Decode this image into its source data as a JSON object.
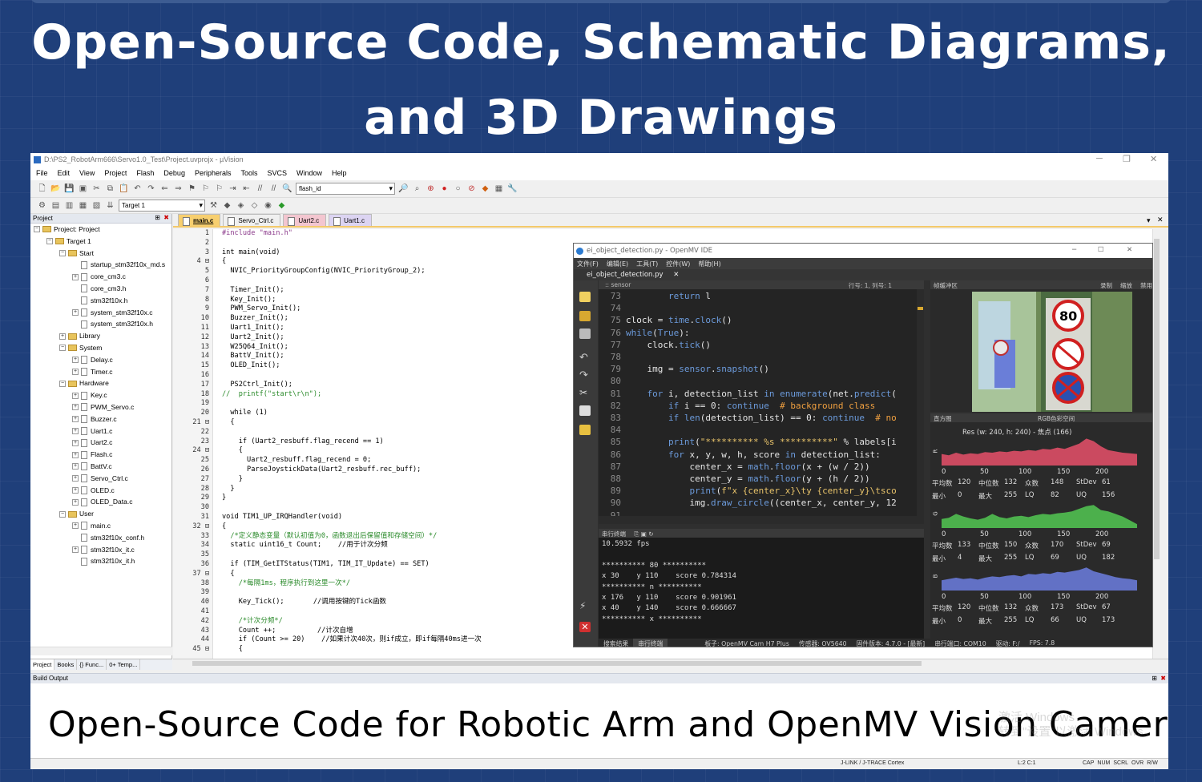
{
  "banner": {
    "line1": "Open-Source Code, Schematic Diagrams,",
    "line2": "and 3D Drawings"
  },
  "caption": "Open-Source Code for Robotic Arm and OpenMV Vision Camera",
  "watermark": {
    "line1": "激活 Windows",
    "line2": "转到\"设置\"以激活 Windows。"
  },
  "keil": {
    "title": "D:\\PS2_RobotArm666\\Servo1.0_Test\\Project.uvprojx - µVision",
    "menu": [
      "File",
      "Edit",
      "View",
      "Project",
      "Flash",
      "Debug",
      "Peripherals",
      "Tools",
      "SVCS",
      "Window",
      "Help"
    ],
    "find_combo": "flash_id",
    "target_combo": "Target 1",
    "project_header": "Project",
    "tree": [
      {
        "d": 0,
        "exp": "−",
        "icon": "proj",
        "label": "Project: Project"
      },
      {
        "d": 1,
        "exp": "−",
        "icon": "target",
        "label": "Target 1"
      },
      {
        "d": 2,
        "exp": "−",
        "icon": "folder",
        "label": "Start"
      },
      {
        "d": 3,
        "exp": "",
        "icon": "file",
        "label": "startup_stm32f10x_md.s"
      },
      {
        "d": 3,
        "exp": "+",
        "icon": "file",
        "label": "core_cm3.c"
      },
      {
        "d": 3,
        "exp": "",
        "icon": "file",
        "label": "core_cm3.h"
      },
      {
        "d": 3,
        "exp": "",
        "icon": "file",
        "label": "stm32f10x.h"
      },
      {
        "d": 3,
        "exp": "+",
        "icon": "file",
        "label": "system_stm32f10x.c"
      },
      {
        "d": 3,
        "exp": "",
        "icon": "file",
        "label": "system_stm32f10x.h"
      },
      {
        "d": 2,
        "exp": "+",
        "icon": "folder",
        "label": "Library"
      },
      {
        "d": 2,
        "exp": "−",
        "icon": "folder",
        "label": "System"
      },
      {
        "d": 3,
        "exp": "+",
        "icon": "file",
        "label": "Delay.c"
      },
      {
        "d": 3,
        "exp": "+",
        "icon": "file",
        "label": "Timer.c"
      },
      {
        "d": 2,
        "exp": "−",
        "icon": "folder",
        "label": "Hardware"
      },
      {
        "d": 3,
        "exp": "+",
        "icon": "file",
        "label": "Key.c"
      },
      {
        "d": 3,
        "exp": "+",
        "icon": "file",
        "label": "PWM_Servo.c"
      },
      {
        "d": 3,
        "exp": "+",
        "icon": "file",
        "label": "Buzzer.c"
      },
      {
        "d": 3,
        "exp": "+",
        "icon": "file",
        "label": "Uart1.c"
      },
      {
        "d": 3,
        "exp": "+",
        "icon": "file",
        "label": "Uart2.c"
      },
      {
        "d": 3,
        "exp": "+",
        "icon": "file",
        "label": "Flash.c"
      },
      {
        "d": 3,
        "exp": "+",
        "icon": "file",
        "label": "BattV.c"
      },
      {
        "d": 3,
        "exp": "+",
        "icon": "file",
        "label": "Servo_Ctrl.c"
      },
      {
        "d": 3,
        "exp": "+",
        "icon": "file",
        "label": "OLED.c"
      },
      {
        "d": 3,
        "exp": "+",
        "icon": "file",
        "label": "OLED_Data.c"
      },
      {
        "d": 2,
        "exp": "−",
        "icon": "folder",
        "label": "User"
      },
      {
        "d": 3,
        "exp": "+",
        "icon": "file",
        "label": "main.c"
      },
      {
        "d": 3,
        "exp": "",
        "icon": "file",
        "label": "stm32f10x_conf.h"
      },
      {
        "d": 3,
        "exp": "+",
        "icon": "file",
        "label": "stm32f10x_it.c"
      },
      {
        "d": 3,
        "exp": "",
        "icon": "file",
        "label": "stm32f10x_it.h"
      }
    ],
    "pane_tabs": [
      "Project",
      "Books",
      "{} Func...",
      "0+ Temp..."
    ],
    "editor_tabs": [
      "main.c",
      "Servo_Ctrl.c",
      "Uart2.c",
      "Uart1.c"
    ],
    "code": [
      {
        "t": "#include \"main.h\"",
        "k": "pp"
      },
      {
        "t": "",
        "k": ""
      },
      {
        "t": "int main(void)",
        "k": ""
      },
      {
        "t": "{",
        "k": ""
      },
      {
        "t": "  NVIC_PriorityGroupConfig(NVIC_PriorityGroup_2);",
        "k": ""
      },
      {
        "t": "",
        "k": ""
      },
      {
        "t": "  Timer_Init();",
        "k": ""
      },
      {
        "t": "  Key_Init();",
        "k": ""
      },
      {
        "t": "  PWM_Servo_Init();",
        "k": ""
      },
      {
        "t": "  Buzzer_Init();",
        "k": ""
      },
      {
        "t": "  Uart1_Init();",
        "k": ""
      },
      {
        "t": "  Uart2_Init();",
        "k": ""
      },
      {
        "t": "  W25Q64_Init();",
        "k": ""
      },
      {
        "t": "  BattV_Init();",
        "k": ""
      },
      {
        "t": "  OLED_Init();",
        "k": ""
      },
      {
        "t": "",
        "k": ""
      },
      {
        "t": "  PS2Ctrl_Init();",
        "k": ""
      },
      {
        "t": "//  printf(\"start\\r\\n\");",
        "k": "cm"
      },
      {
        "t": "",
        "k": ""
      },
      {
        "t": "  while (1)",
        "k": ""
      },
      {
        "t": "  {",
        "k": ""
      },
      {
        "t": "",
        "k": ""
      },
      {
        "t": "    if (Uart2_resbuff.flag_recend == 1)",
        "k": ""
      },
      {
        "t": "    {",
        "k": ""
      },
      {
        "t": "      Uart2_resbuff.flag_recend = 0;",
        "k": ""
      },
      {
        "t": "      ParseJoystickData(Uart2_resbuff.rec_buff);",
        "k": ""
      },
      {
        "t": "    }",
        "k": ""
      },
      {
        "t": "  }",
        "k": ""
      },
      {
        "t": "}",
        "k": ""
      },
      {
        "t": "",
        "k": ""
      },
      {
        "t": "void TIM1_UP_IRQHandler(void)",
        "k": ""
      },
      {
        "t": "{",
        "k": ""
      },
      {
        "t": "  /*定义静态变量（默认初值为0，函数退出后保留值和存储空间）*/",
        "k": "cm"
      },
      {
        "t": "  static uint16_t Count;    //用于计次分频",
        "k": ""
      },
      {
        "t": "",
        "k": ""
      },
      {
        "t": "  if (TIM_GetITStatus(TIM1, TIM_IT_Update) == SET)",
        "k": ""
      },
      {
        "t": "  {",
        "k": ""
      },
      {
        "t": "    /*每隔1ms，程序执行到这里一次*/",
        "k": "cm"
      },
      {
        "t": "",
        "k": ""
      },
      {
        "t": "    Key_Tick();       //调用按键的Tick函数",
        "k": ""
      },
      {
        "t": "",
        "k": ""
      },
      {
        "t": "    /*计次分频*/",
        "k": "cm"
      },
      {
        "t": "    Count ++;          //计次自增",
        "k": ""
      },
      {
        "t": "    if (Count >= 20)    //如果计次40次，则if成立，即if每隔40ms进一次",
        "k": ""
      },
      {
        "t": "    {",
        "k": ""
      }
    ],
    "build_header": "Build Output",
    "status": {
      "debugger": "J-LINK / J-TRACE Cortex",
      "pos": "L:2 C:1",
      "flags": [
        "CAP",
        "NUM",
        "SCRL",
        "OVR",
        "R/W"
      ]
    }
  },
  "openmv": {
    "title": "ei_object_detection.py - OpenMV IDE",
    "menu": [
      "文件(F)",
      "编辑(E)",
      "工具(T)",
      "控件(W)",
      "帮助(H)"
    ],
    "tab": "ei_object_detection.py",
    "editor_bar": ":: sensor",
    "editor_pos": "行号: 1, 列号: 1",
    "fb_label": "帧缓冲区",
    "fb_buttons": [
      "录制",
      "缩放",
      "禁用"
    ],
    "code": [
      {
        "n": "73",
        "parts": [
          [
            "        ",
            ""
          ],
          [
            "return",
            "kw"
          ],
          [
            " l",
            ""
          ]
        ]
      },
      {
        "n": "74",
        "parts": []
      },
      {
        "n": "75",
        "parts": [
          [
            "clock = ",
            ""
          ],
          [
            "time",
            "kw"
          ],
          [
            ".",
            ""
          ],
          [
            "clock",
            "kw"
          ],
          [
            "()",
            ""
          ]
        ]
      },
      {
        "n": "76",
        "parts": [
          [
            "while",
            "kw"
          ],
          [
            "(",
            ""
          ],
          [
            "True",
            "kw"
          ],
          [
            "):",
            ""
          ]
        ]
      },
      {
        "n": "77",
        "parts": [
          [
            "    clock.",
            ""
          ],
          [
            "tick",
            "kw"
          ],
          [
            "()",
            ""
          ]
        ]
      },
      {
        "n": "78",
        "parts": []
      },
      {
        "n": "79",
        "parts": [
          [
            "    img = ",
            ""
          ],
          [
            "sensor",
            "kw"
          ],
          [
            ".",
            ""
          ],
          [
            "snapshot",
            "kw"
          ],
          [
            "()",
            ""
          ]
        ]
      },
      {
        "n": "80",
        "parts": []
      },
      {
        "n": "81",
        "parts": [
          [
            "    ",
            ""
          ],
          [
            "for",
            "kw"
          ],
          [
            " i, detection_list ",
            ""
          ],
          [
            "in",
            "kw"
          ],
          [
            " ",
            ""
          ],
          [
            "enumerate",
            "kw"
          ],
          [
            "(net.",
            ""
          ],
          [
            "predict",
            "kw"
          ],
          [
            "(",
            ""
          ]
        ]
      },
      {
        "n": "82",
        "parts": [
          [
            "        ",
            ""
          ],
          [
            "if",
            "kw"
          ],
          [
            " i == 0: ",
            ""
          ],
          [
            "continue",
            "kw"
          ],
          [
            "  # background class",
            "cm2"
          ]
        ]
      },
      {
        "n": "83",
        "parts": [
          [
            "        ",
            ""
          ],
          [
            "if",
            "kw"
          ],
          [
            " ",
            ""
          ],
          [
            "len",
            "kw"
          ],
          [
            "(detection_list) == 0: ",
            ""
          ],
          [
            "continue",
            "kw"
          ],
          [
            "  # no",
            "cm2"
          ]
        ]
      },
      {
        "n": "84",
        "parts": []
      },
      {
        "n": "85",
        "parts": [
          [
            "        ",
            ""
          ],
          [
            "print",
            "kw"
          ],
          [
            "(",
            ""
          ],
          [
            "\"********** %s **********\"",
            "st"
          ],
          [
            " % labels[i",
            ""
          ]
        ]
      },
      {
        "n": "86",
        "parts": [
          [
            "        ",
            ""
          ],
          [
            "for",
            "kw"
          ],
          [
            " x, y, w, h, score ",
            ""
          ],
          [
            "in",
            "kw"
          ],
          [
            " detection_list:",
            ""
          ]
        ]
      },
      {
        "n": "87",
        "parts": [
          [
            "            center_x = ",
            ""
          ],
          [
            "math",
            "kw"
          ],
          [
            ".",
            ""
          ],
          [
            "floor",
            "kw"
          ],
          [
            "(x + (w / 2))",
            ""
          ]
        ]
      },
      {
        "n": "88",
        "parts": [
          [
            "            center_y = ",
            ""
          ],
          [
            "math",
            "kw"
          ],
          [
            ".",
            ""
          ],
          [
            "floor",
            "kw"
          ],
          [
            "(y + (h / 2))",
            ""
          ]
        ]
      },
      {
        "n": "89",
        "parts": [
          [
            "            ",
            ""
          ],
          [
            "print",
            "kw"
          ],
          [
            "(",
            ""
          ],
          [
            "f\"x {center_x}\\ty {center_y}\\tsco",
            "st"
          ]
        ]
      },
      {
        "n": "90",
        "parts": [
          [
            "            img.",
            ""
          ],
          [
            "draw_circle",
            "kw"
          ],
          [
            "((center_x, center_y, 12",
            ""
          ]
        ]
      },
      {
        "n": "91",
        "parts": []
      }
    ],
    "terminal_header": "串行终端",
    "terminal": [
      "10.5932 fps",
      "",
      "********** 80 **********",
      "x 30    y 110    score 0.784314",
      "********** n **********",
      "x 176   y 110    score 0.901961",
      "x 40    y 140    score 0.666667",
      "********** x **********"
    ],
    "status": [
      "搜索结果",
      "串行终端",
      "板子: OpenMV Cam H7 Plus",
      "传感器: OV5640",
      "固件版本: 4.7.0 - [最新]",
      "串行端口: COM10",
      "驱动: F:/",
      "FPS: 7.8"
    ],
    "hist_header": "直方图",
    "hist_space": "RGB色彩空间",
    "res_text": "Res  (w:  240,  h:  240)  - 焦点  (166)",
    "axis": [
      "0",
      "50",
      "100",
      "150",
      "200"
    ],
    "channels": [
      {
        "name": "R",
        "color": "#e8506a",
        "stats": [
          [
            "平均数",
            "120"
          ],
          [
            "中位数",
            "132"
          ],
          [
            "众数",
            "148"
          ],
          [
            "StDev",
            "61"
          ],
          [
            "最小",
            "0"
          ],
          [
            "最大",
            "255"
          ],
          [
            "LQ",
            "82"
          ],
          [
            "UQ",
            "156"
          ]
        ]
      },
      {
        "name": "G",
        "color": "#52c852",
        "stats": [
          [
            "平均数",
            "133"
          ],
          [
            "中位数",
            "150"
          ],
          [
            "众数",
            "170"
          ],
          [
            "StDev",
            "69"
          ],
          [
            "最小",
            "4"
          ],
          [
            "最大",
            "255"
          ],
          [
            "LQ",
            "69"
          ],
          [
            "UQ",
            "182"
          ]
        ]
      },
      {
        "name": "B",
        "color": "#6c7ee0",
        "stats": [
          [
            "平均数",
            "120"
          ],
          [
            "中位数",
            "132"
          ],
          [
            "众数",
            "173"
          ],
          [
            "StDev",
            "67"
          ],
          [
            "最小",
            "0"
          ],
          [
            "最大",
            "255"
          ],
          [
            "LQ",
            "66"
          ],
          [
            "UQ",
            "173"
          ]
        ]
      }
    ]
  }
}
